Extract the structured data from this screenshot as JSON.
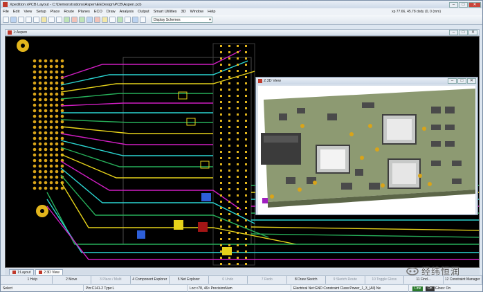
{
  "window": {
    "title": "Xpedition xPCB Layout - C:\\Demonstrations\\Aspen\\EEDesign\\PCB\\Aspen.pcb",
    "min_label": "–",
    "max_label": "□",
    "close_label": "✕"
  },
  "menu": [
    "File",
    "Edit",
    "View",
    "Setup",
    "Place",
    "Route",
    "Planes",
    "ECO",
    "Draw",
    "Analysis",
    "Output",
    "Smart Utilities",
    "3D",
    "Window",
    "Help"
  ],
  "coordinates": "xp 77.66, 45.78  dxdy (0, 0  (mm)",
  "toolbar": {
    "scheme_value": "Display Schemes",
    "icons": [
      "open-icon",
      "save-icon",
      "print-icon",
      "undo-icon",
      "redo-icon",
      "select-icon",
      "zoom-in-icon",
      "zoom-out-icon",
      "zoom-fit-icon",
      "route-icon",
      "via-icon",
      "plane-icon",
      "drc-icon",
      "layers-icon",
      "display-icon",
      "grid-icon",
      "measure-icon",
      "3d-icon",
      "help-icon"
    ]
  },
  "document": {
    "title": "1:Aspen"
  },
  "view3d": {
    "title": "2:3D View"
  },
  "tabs": [
    {
      "label": "1:Layout",
      "active": false
    },
    {
      "label": "2:3D View",
      "active": true
    }
  ],
  "function_keys": [
    {
      "label": "1 Help",
      "enabled": true
    },
    {
      "label": "2 Move",
      "enabled": true
    },
    {
      "label": "3 Place / Multi",
      "enabled": false
    },
    {
      "label": "4 Component Explorer",
      "enabled": true
    },
    {
      "label": "5 Net Explorer",
      "enabled": true
    },
    {
      "label": "6 Undo",
      "enabled": false
    },
    {
      "label": "7 Redo",
      "enabled": false
    },
    {
      "label": "8 Draw Sketch",
      "enabled": true
    },
    {
      "label": "9 Sketch Route",
      "enabled": false
    },
    {
      "label": "10 Toggle Gloss",
      "enabled": false
    },
    {
      "label": "11 Find...",
      "enabled": true
    },
    {
      "label": "12 Constraint Manager",
      "enabled": true
    }
  ],
  "status": {
    "mode": "Select",
    "pin": "Pin:C141-2 Type:L",
    "loc": "Loc:<78, 46> PrecisionNum",
    "net": "Electrical Net:GND Constraint Class:Power_1_3_(All) Ne",
    "indicator1": "Line",
    "indicator2": "On",
    "gloss": "Gloss: On"
  },
  "watermark": {
    "text": "经纬恒润"
  },
  "colors": {
    "pcb_bg": "#000000",
    "trace_green": "#27b05a",
    "trace_magenta": "#d01ec2",
    "trace_cyan": "#2bd6d2",
    "trace_yellow": "#e6d21a",
    "pad_yellow": "#e2b51c",
    "board_green": "#8d9a72"
  }
}
